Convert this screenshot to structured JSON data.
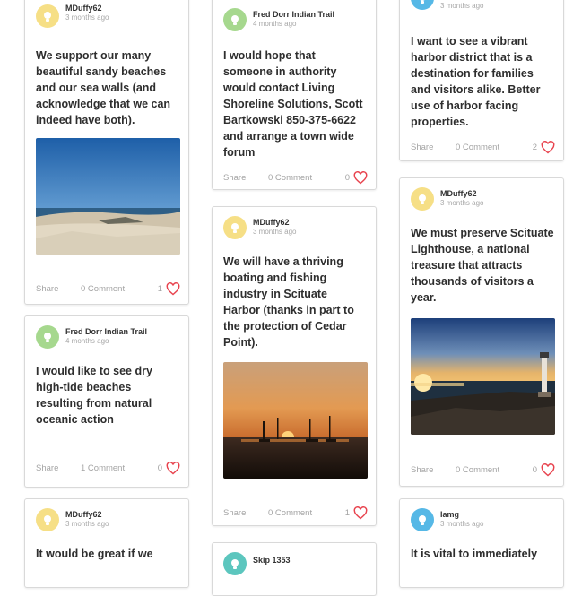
{
  "colors": {
    "accent": "#e8434e",
    "avatar_yellow": "#f6df86",
    "avatar_green": "#a6d88e",
    "avatar_blue": "#56b8e6",
    "avatar_teal": "#5cc6be"
  },
  "actions": {
    "share": "Share"
  },
  "cards": [
    {
      "user": "MDuffy62",
      "time": "3 months ago",
      "text": "We support our many beautiful sandy beaches and our sea walls (and acknowledge that we can indeed have both).",
      "comments": "0 Comment",
      "likes": "1",
      "photo": "beach"
    },
    {
      "user": "Fred Dorr Indian Trail",
      "time": "4 months ago",
      "text": "I would like to see dry high-tide beaches resulting from natural oceanic action",
      "comments": "1 Comment",
      "likes": "0"
    },
    {
      "user": "MDuffy62",
      "time": "3 months ago",
      "text": "It would be great if we"
    },
    {
      "user": "Fred Dorr Indian Trail",
      "time": "4 months ago",
      "text": "I would hope that someone in authority would contact Living Shoreline Solutions, Scott Bartkowski 850-375-6622 and arrange a town wide forum",
      "comments": "0 Comment",
      "likes": "0"
    },
    {
      "user": "MDuffy62",
      "time": "3 months ago",
      "text": "We will have a thriving boating and fishing industry in Scituate Harbor (thanks in part to the protection of Cedar Point).",
      "comments": "0 Comment",
      "likes": "1",
      "photo": "harbor sunset"
    },
    {
      "user": "Skip 1353"
    },
    {
      "time": "3 months ago",
      "text": "I want to see a vibrant harbor district that is a destination for families and visitors alike. Better use of harbor facing properties.",
      "comments": "0 Comment",
      "likes": "2"
    },
    {
      "user": "MDuffy62",
      "time": "3 months ago",
      "text": "We must preserve Scituate Lighthouse, a national treasure that attracts thousands of visitors a year.",
      "comments": "0 Comment",
      "likes": "0",
      "photo": "lighthouse"
    },
    {
      "user": "lamg",
      "time": "3 months ago",
      "text": "It is vital to immediately"
    }
  ]
}
